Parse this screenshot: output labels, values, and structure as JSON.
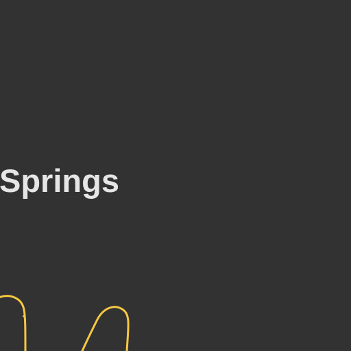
{
  "heading": {
    "text": "Springs"
  },
  "decor": {
    "stroke_color": "#f5c842",
    "background": "#323232",
    "text_color": "#e6e6e6"
  }
}
